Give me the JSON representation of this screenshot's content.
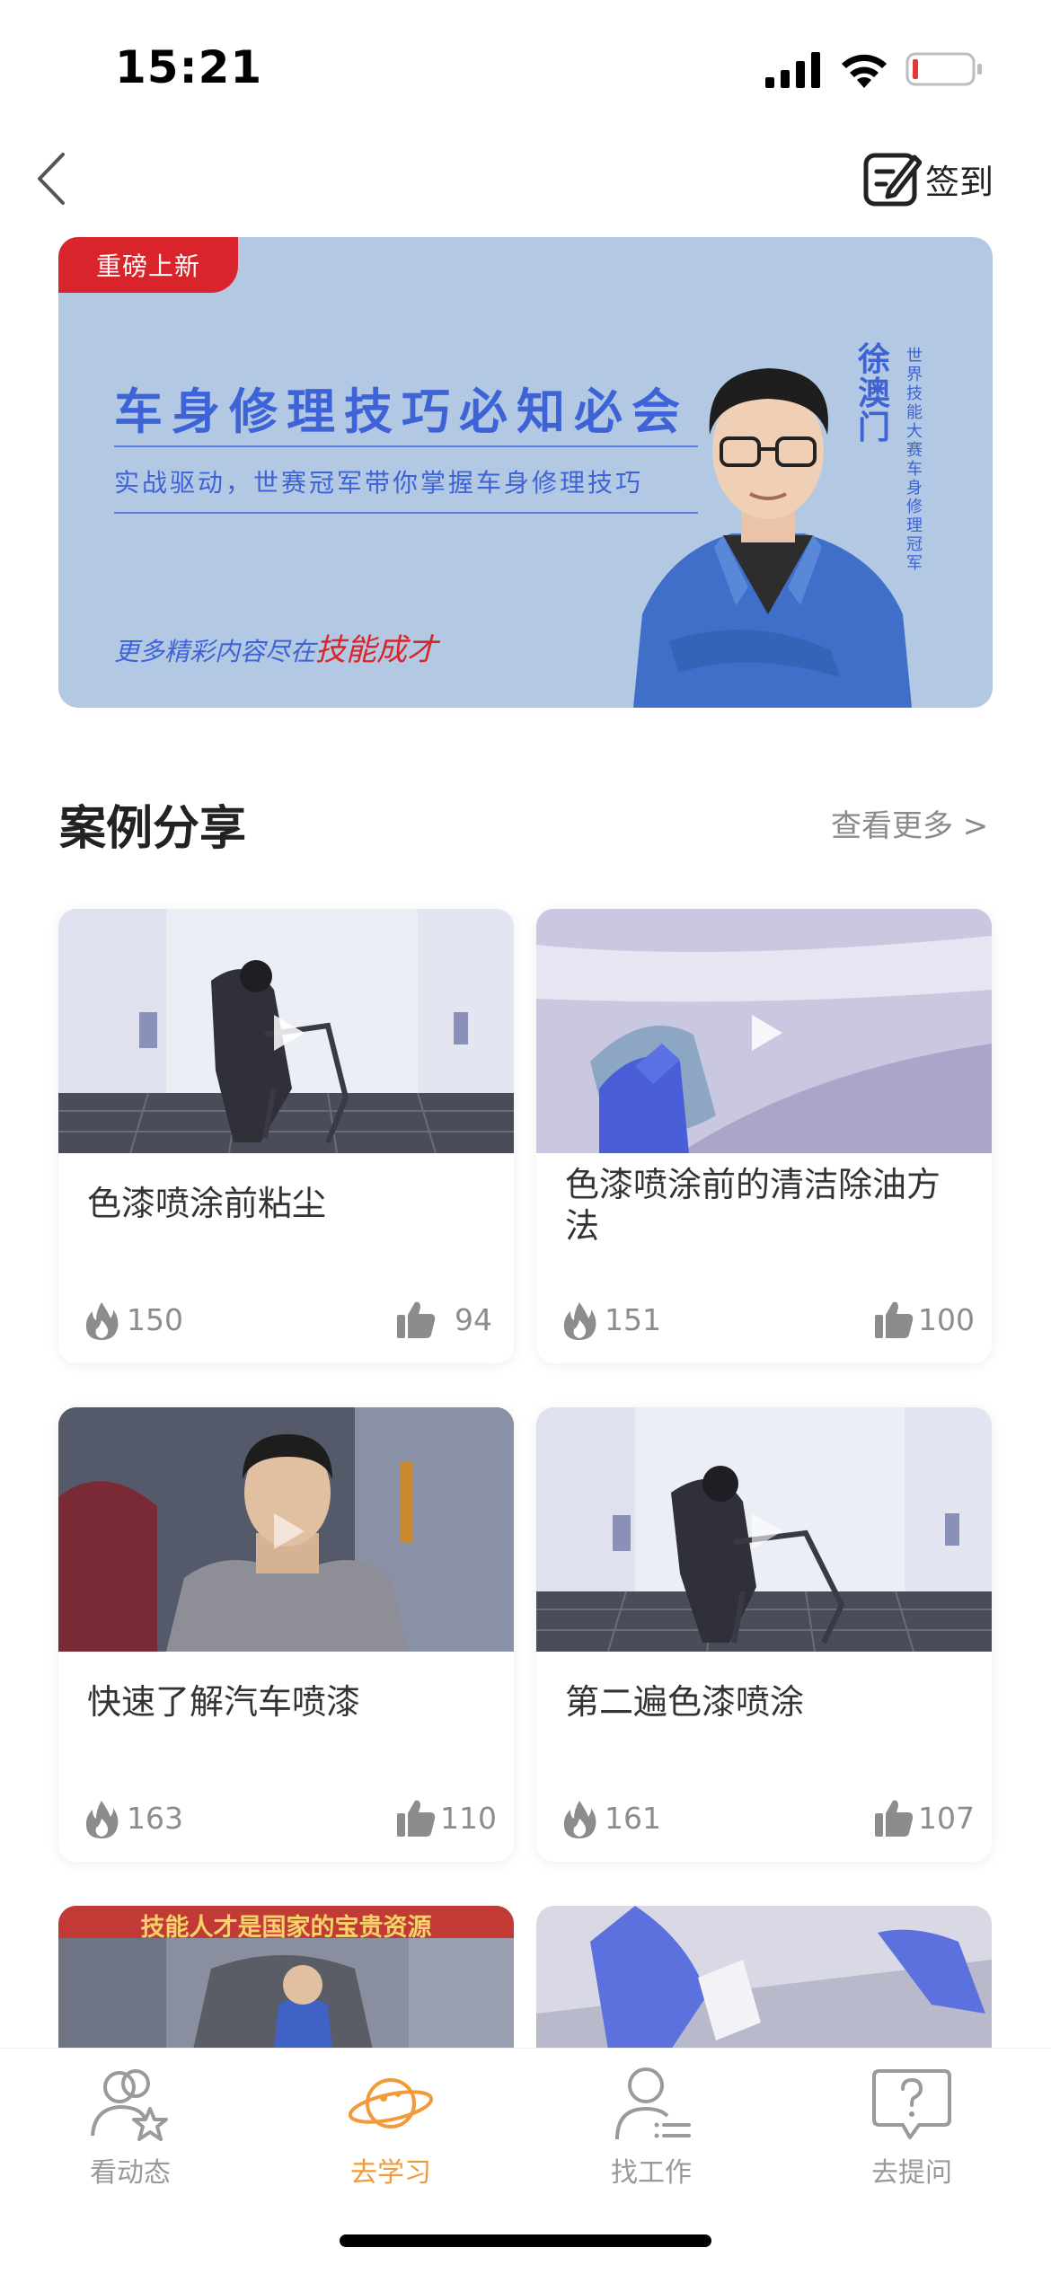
{
  "status_bar": {
    "time": "15:21",
    "icons": [
      "signal-icon",
      "wifi-icon",
      "battery-icon"
    ],
    "battery_color": "#e03a3a"
  },
  "nav": {
    "back_icon": "chevron-left-icon",
    "checkin_label": "签到",
    "checkin_icon": "edit-checkin-icon"
  },
  "banner": {
    "tag": "重磅上新",
    "title": "车身修理技巧必知必会",
    "subtitle": "实战驱动，世赛冠军带你掌握车身修理技巧",
    "more_prefix": "更多精彩内容尽在",
    "more_highlight": "技能成才",
    "person_name": "徐澳门",
    "person_honor": "世界技能大赛车身修理冠军",
    "background_color": "#b3c8e3",
    "title_color": "#3d63d6"
  },
  "section": {
    "title": "案例分享",
    "more_label": "查看更多 >"
  },
  "cards": [
    {
      "title": "色漆喷涂前粘尘",
      "views": "150",
      "likes": "94"
    },
    {
      "title": "色漆喷涂前的清洁除油方法",
      "views": "151",
      "likes": "100"
    },
    {
      "title": "快速了解汽车喷漆",
      "views": "163",
      "likes": "110"
    },
    {
      "title": "第二遍色漆喷涂",
      "views": "161",
      "likes": "107"
    }
  ],
  "partial_cards": {
    "left_banner_text": "技能人才是国家的宝贵资源"
  },
  "tabbar": {
    "active_color": "#f29a38",
    "inactive_color": "#999999",
    "tabs": [
      {
        "label": "看动态",
        "icon": "people-star-icon",
        "active": false
      },
      {
        "label": "去学习",
        "icon": "planet-icon",
        "active": true
      },
      {
        "label": "找工作",
        "icon": "person-list-icon",
        "active": false
      },
      {
        "label": "去提问",
        "icon": "question-bubble-icon",
        "active": false
      }
    ]
  }
}
